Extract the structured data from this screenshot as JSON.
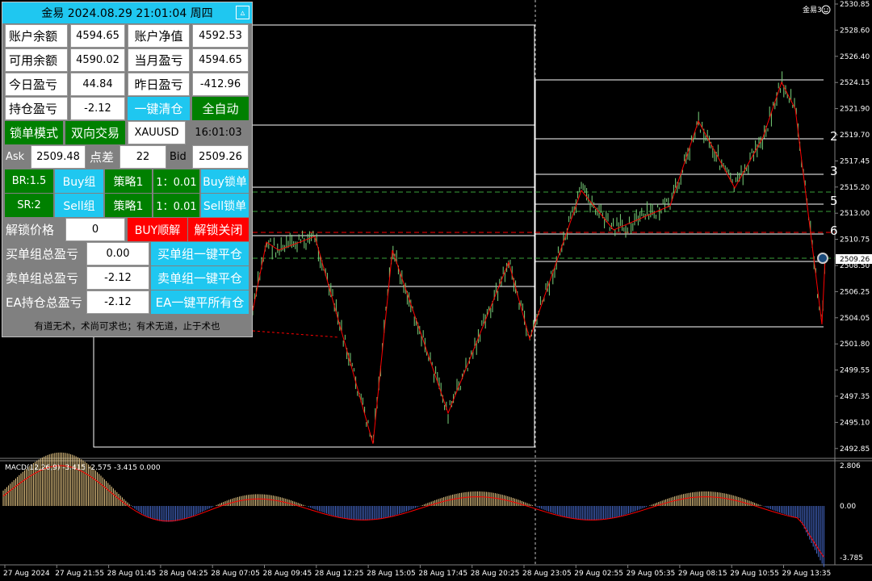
{
  "panel": {
    "title": "金易 2024.08.29 21:01:04 周四",
    "collapse_icon": "▵",
    "account": {
      "balance_label": "账户余额",
      "balance": "4594.65",
      "equity_label": "账户净值",
      "equity": "4592.53",
      "free_margin_label": "可用余额",
      "free_margin": "4590.02",
      "month_pl_label": "当月盈亏",
      "month_pl": "4594.65",
      "today_pl_label": "今日盈亏",
      "today_pl": "44.84",
      "yesterday_pl_label": "昨日盈亏",
      "yesterday_pl": "-412.96",
      "position_pl_label": "持仓盈亏",
      "position_pl": "-2.12"
    },
    "buttons": {
      "close_all": "一键清仓",
      "auto": "全自动",
      "lock_mode": "锁单模式",
      "two_way": "双向交易",
      "symbol": "XAUUSD",
      "time": "16:01:03"
    },
    "quote": {
      "ask_label": "Ask",
      "ask": "2509.48",
      "spread_label": "点差",
      "spread": "22",
      "bid_label": "Bid",
      "bid": "2509.26"
    },
    "buy_row": {
      "br": "BR:1.5",
      "group": "Buy组",
      "strategy": "策略1",
      "ratio": "1：0.01",
      "lock": "Buy锁单"
    },
    "sell_row": {
      "sr": "SR:2",
      "group": "Sell组",
      "strategy": "策略1",
      "ratio": "1：0.01",
      "lock": "Sell锁单"
    },
    "unlock": {
      "label": "解锁价格",
      "value": "0",
      "buy_unlock": "BUY顺解",
      "close_unlock": "解锁关闭"
    },
    "totals": {
      "buy_label": "买单组总盈亏",
      "buy_value": "0.00",
      "buy_close": "买单组一键平仓",
      "sell_label": "卖单组总盈亏",
      "sell_value": "-2.12",
      "sell_close": "卖单组一键平仓",
      "ea_label": "EA持仓总盈亏",
      "ea_value": "-2.12",
      "ea_close": "EA一键平所有仓"
    },
    "motto": "有道无术，术尚可求也；有术无道，止于术也"
  },
  "chart": {
    "ea_tag": "金易3",
    "smile_icon": "smiley-icon",
    "current_price": "2509.26",
    "right_level_labels": [
      "2",
      "3",
      "5",
      "6"
    ],
    "colors": {
      "background": "#000000",
      "bar": "#7bd27b",
      "zigzag": "#ff0000",
      "dash_line": "#3aa03a",
      "axis_text": "#ffffff",
      "macd_pos": "#f2d08a",
      "macd_neg": "#4a6fd6",
      "signal": "#ff0000"
    }
  },
  "price_axis": [
    "2530.85",
    "2528.60",
    "2526.40",
    "2524.15",
    "2521.90",
    "2519.70",
    "2517.45",
    "2515.20",
    "2513.00",
    "2510.75",
    "2508.50",
    "2506.25",
    "2504.05",
    "2501.80",
    "2499.55",
    "2497.35",
    "2495.10",
    "2492.85"
  ],
  "macd": {
    "label": "MACD(12,26,9) -3.415 -2.575 -3.415 0.000",
    "axis": [
      "2.806",
      "0.00",
      "-3.785"
    ]
  },
  "time_axis": [
    "27 Aug 2024",
    "27 Aug 21:55",
    "28 Aug 01:45",
    "28 Aug 04:25",
    "28 Aug 07:05",
    "28 Aug 09:45",
    "28 Aug 12:25",
    "28 Aug 15:05",
    "28 Aug 17:45",
    "28 Aug 20:25",
    "28 Aug 23:05",
    "29 Aug 02:55",
    "29 Aug 05:35",
    "29 Aug 08:15",
    "29 Aug 10:55",
    "29 Aug 13:35"
  ]
}
